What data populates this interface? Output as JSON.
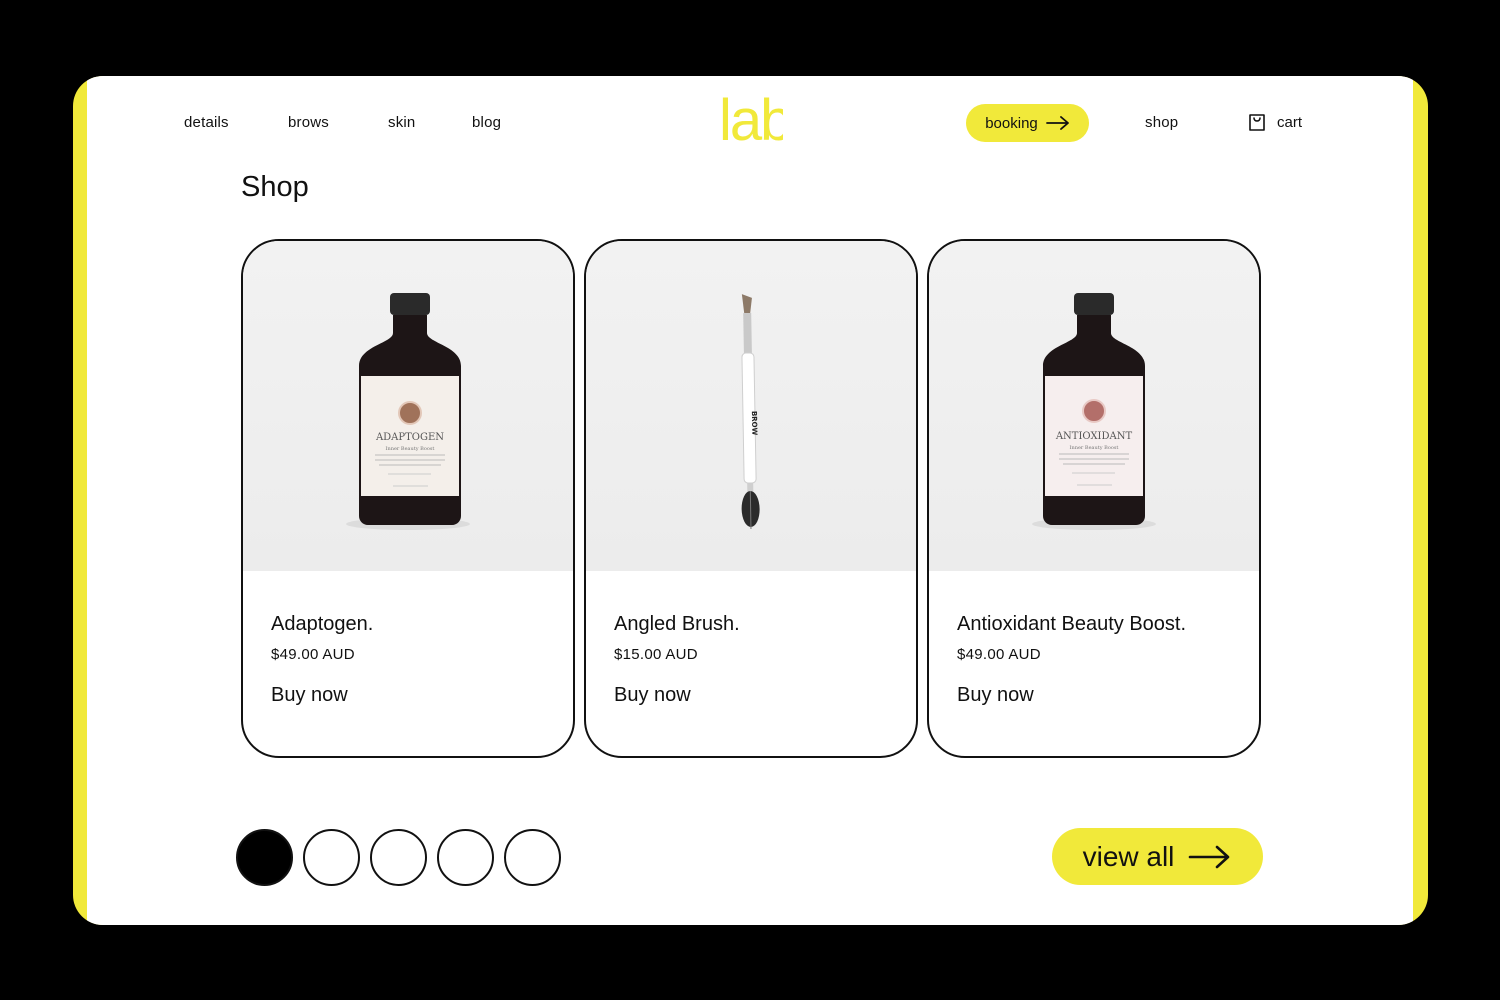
{
  "nav": {
    "left_links": [
      "details",
      "brows",
      "skin",
      "blog"
    ],
    "logo_text": "lab",
    "booking_label": "booking",
    "shop_label": "shop",
    "cart_label": "cart"
  },
  "shop": {
    "heading": "Shop",
    "products": [
      {
        "title": "Adaptogen.",
        "price": "$49.00 AUD",
        "buy_label": "Buy now",
        "label_text": "ADAPTOGEN",
        "label_sub": "Inner Beauty Boost",
        "label_color": "#f4efea"
      },
      {
        "title": "Angled Brush.",
        "price": "$15.00 AUD",
        "buy_label": "Buy now",
        "brush_text": "BROW"
      },
      {
        "title": "Antioxidant Beauty Boost.",
        "price": "$49.00 AUD",
        "buy_label": "Buy now",
        "label_text": "ANTIOXIDANT",
        "label_sub": "Inner Beauty Boost",
        "label_color": "#f6eeee"
      }
    ],
    "pager": {
      "total": 5,
      "active": 1
    },
    "view_all_label": "view all"
  },
  "colors": {
    "accent": "#f1e93a",
    "background": "#000000",
    "page": "#ffffff",
    "text": "#111111"
  },
  "icons": {
    "booking_arrow": "arrow-right-icon",
    "cart": "shopping-bag-icon",
    "view_all_arrow": "arrow-right-icon"
  }
}
